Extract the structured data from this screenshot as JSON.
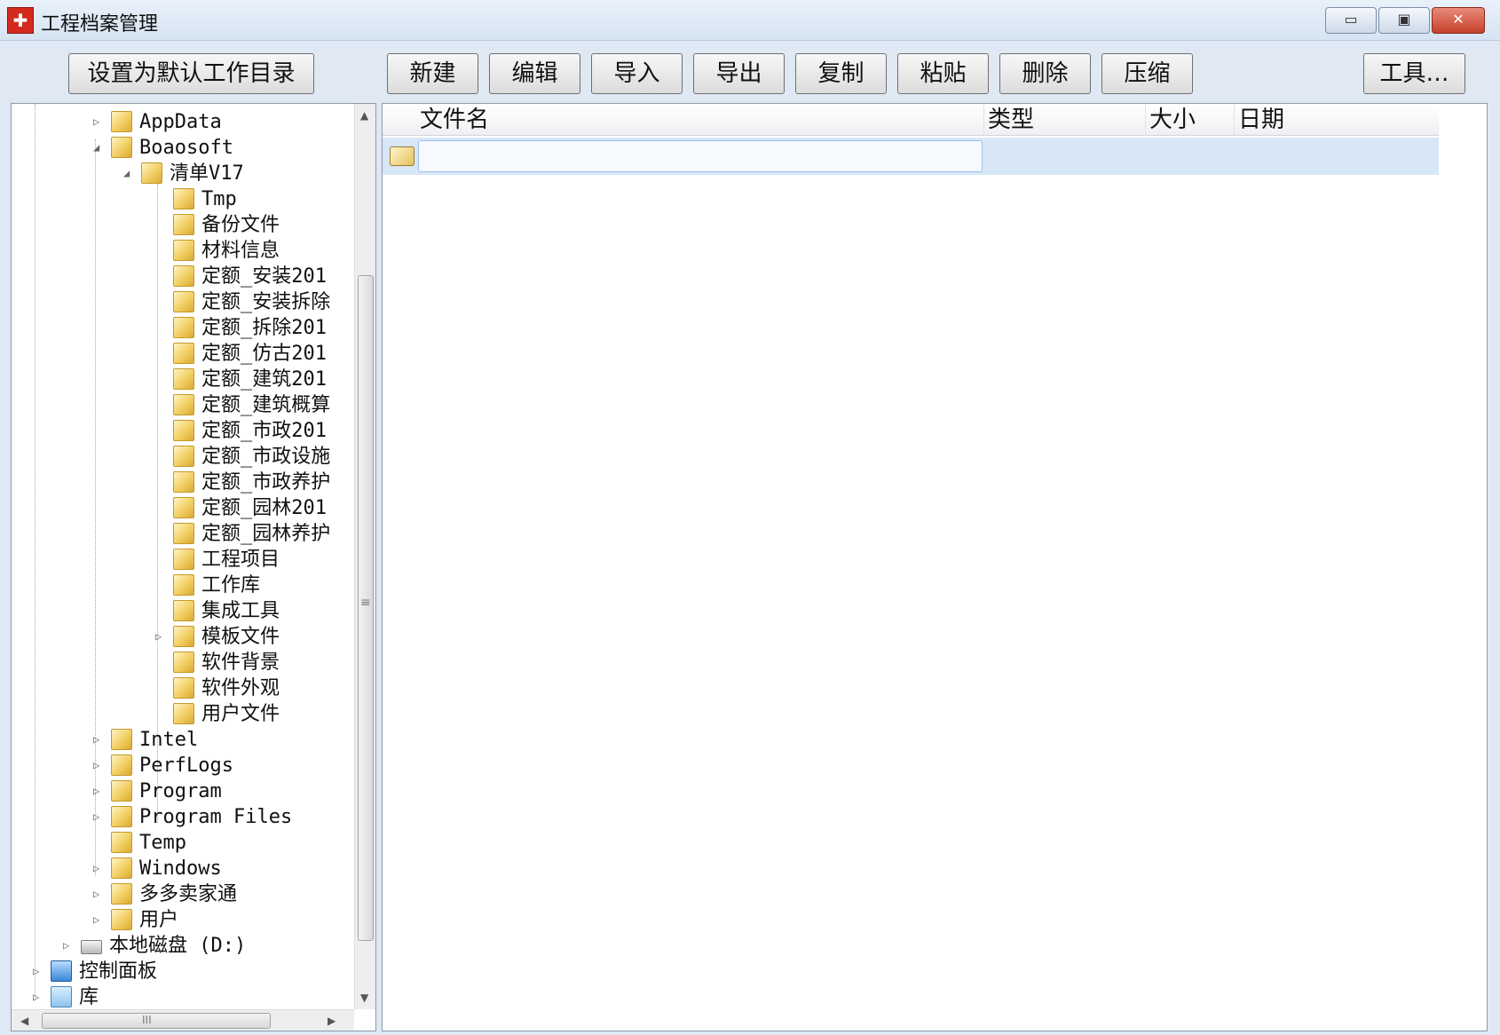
{
  "window": {
    "title": "工程档案管理",
    "icon_name": "app-icon",
    "controls": [
      "minimize-icon",
      "maximize-icon",
      "close-icon"
    ]
  },
  "toolbar": {
    "set_default": "设置为默认工作目录",
    "new": "新建",
    "edit": "编辑",
    "import": "导入",
    "export": "导出",
    "copy": "复制",
    "paste": "粘贴",
    "delete": "删除",
    "compress": "压缩",
    "tools": "工具…"
  },
  "tree": {
    "items": [
      {
        "label": "AppData",
        "expander": "▷"
      },
      {
        "label": "Boaosoft",
        "expander": "◢"
      },
      {
        "label": "清单V17",
        "expander": "◢"
      },
      {
        "label": "Tmp",
        "expander": ""
      },
      {
        "label": "备份文件",
        "expander": ""
      },
      {
        "label": "材料信息",
        "expander": ""
      },
      {
        "label": "定额_安装201",
        "expander": ""
      },
      {
        "label": "定额_安装拆除",
        "expander": ""
      },
      {
        "label": "定额_拆除201",
        "expander": ""
      },
      {
        "label": "定额_仿古201",
        "expander": ""
      },
      {
        "label": "定额_建筑201",
        "expander": ""
      },
      {
        "label": "定额_建筑概算",
        "expander": ""
      },
      {
        "label": "定额_市政201",
        "expander": ""
      },
      {
        "label": "定额_市政设施",
        "expander": ""
      },
      {
        "label": "定额_市政养护",
        "expander": ""
      },
      {
        "label": "定额_园林201",
        "expander": ""
      },
      {
        "label": "定额_园林养护",
        "expander": ""
      },
      {
        "label": "工程项目",
        "expander": ""
      },
      {
        "label": "工作库",
        "expander": ""
      },
      {
        "label": "集成工具",
        "expander": ""
      },
      {
        "label": "模板文件",
        "expander": "▷"
      },
      {
        "label": "软件背景",
        "expander": ""
      },
      {
        "label": "软件外观",
        "expander": ""
      },
      {
        "label": "用户文件",
        "expander": ""
      },
      {
        "label": "Intel",
        "expander": "▷"
      },
      {
        "label": "PerfLogs",
        "expander": "▷"
      },
      {
        "label": "Program",
        "expander": "▷"
      },
      {
        "label": "Program Files",
        "expander": "▷"
      },
      {
        "label": "Temp",
        "expander": ""
      },
      {
        "label": "Windows",
        "expander": "▷"
      },
      {
        "label": "多多卖家通",
        "expander": "▷"
      },
      {
        "label": "用户",
        "expander": "▷"
      },
      {
        "label": "本地磁盘 (D:)",
        "expander": "▷"
      },
      {
        "label": "控制面板",
        "expander": "▷"
      },
      {
        "label": "库",
        "expander": "▷"
      }
    ],
    "scroll_grip": "≡",
    "hscroll_grip": "III"
  },
  "list": {
    "columns": [
      "文件名",
      "类型",
      "大小",
      "日期"
    ],
    "rows": [
      {
        "name": "",
        "type": "",
        "size": "",
        "date": ""
      }
    ]
  }
}
